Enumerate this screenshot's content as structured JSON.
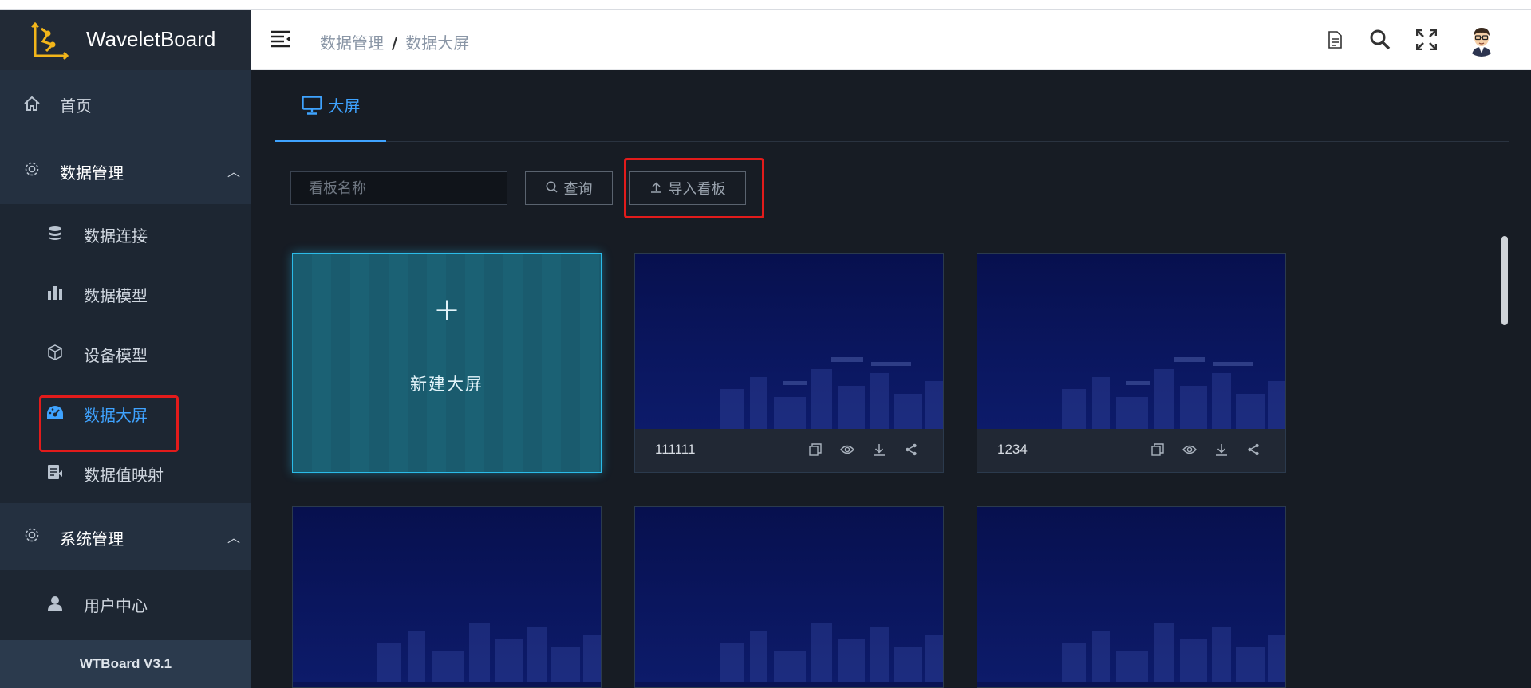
{
  "app": {
    "logo_text": "WaveletBoard",
    "version": "WTBoard V3.1"
  },
  "sidebar": {
    "items": [
      {
        "label": "首页",
        "icon": "home-icon"
      },
      {
        "label": "数据管理",
        "icon": "gear-icon",
        "expanded": true,
        "children": [
          {
            "label": "数据连接",
            "icon": "database-icon"
          },
          {
            "label": "数据模型",
            "icon": "bar-chart-icon"
          },
          {
            "label": "设备模型",
            "icon": "cube-icon"
          },
          {
            "label": "数据大屏",
            "icon": "dashboard-icon",
            "active": true
          },
          {
            "label": "数据值映射",
            "icon": "mapping-icon"
          }
        ]
      },
      {
        "label": "系统管理",
        "icon": "gear-icon",
        "expanded": true,
        "children": [
          {
            "label": "用户中心",
            "icon": "user-icon"
          }
        ]
      }
    ]
  },
  "header": {
    "breadcrumb": [
      "数据管理",
      "数据大屏"
    ],
    "icons": [
      "document-icon",
      "search-icon",
      "fullscreen-icon",
      "avatar"
    ]
  },
  "tabs": [
    {
      "label": "大屏",
      "icon": "monitor-icon",
      "active": true
    }
  ],
  "toolbar": {
    "search_placeholder": "看板名称",
    "query_label": "查询",
    "import_label": "导入看板"
  },
  "new_card": {
    "label": "新建大屏",
    "symbol": "+"
  },
  "cards": [
    {
      "name": "111111",
      "actions": [
        "copy-icon",
        "preview-icon",
        "download-icon",
        "share-icon"
      ]
    },
    {
      "name": "1234",
      "actions": [
        "copy-icon",
        "preview-icon",
        "download-icon",
        "share-icon"
      ]
    },
    {
      "name": ""
    },
    {
      "name": ""
    },
    {
      "name": ""
    }
  ],
  "colors": {
    "accent": "#3fa3ff",
    "highlight": "#e21b1b",
    "card_bg": "#0a1354",
    "new_card": "#1a5b6e"
  }
}
